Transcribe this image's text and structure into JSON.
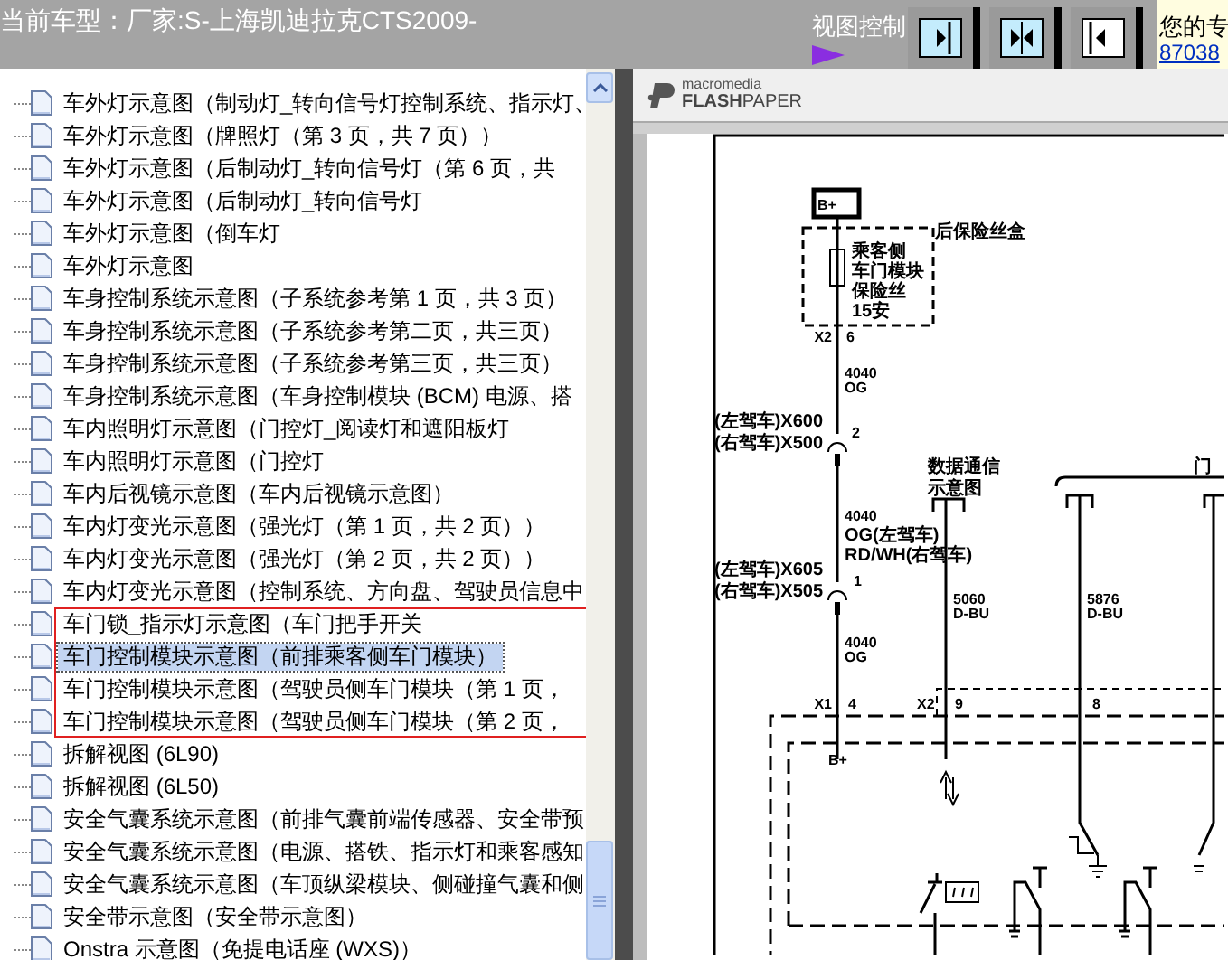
{
  "header": {
    "title": "当前车型：厂家:S-上海凯迪拉克CTS2009-",
    "view_control": "视图控制",
    "notice": "您的专",
    "notice_link": "87038"
  },
  "tree": {
    "sections": [
      {
        "framed": false,
        "items": [
          {
            "label": "车外灯示意图（制动灯_转向信号灯控制系统、指示灯、",
            "selected": false
          },
          {
            "label": "车外灯示意图（牌照灯（第 3 页，共 7 页））",
            "selected": false
          },
          {
            "label": "车外灯示意图（后制动灯_转向信号灯（第 6 页，共",
            "selected": false
          },
          {
            "label": "车外灯示意图（后制动灯_转向信号灯",
            "selected": false
          },
          {
            "label": "车外灯示意图（倒车灯",
            "selected": false
          },
          {
            "label": "车外灯示意图",
            "selected": false
          },
          {
            "label": "车身控制系统示意图（子系统参考第 1 页，共 3 页）",
            "selected": false
          },
          {
            "label": "车身控制系统示意图（子系统参考第二页，共三页）",
            "selected": false
          },
          {
            "label": "车身控制系统示意图（子系统参考第三页，共三页）",
            "selected": false
          },
          {
            "label": "车身控制系统示意图（车身控制模块 (BCM) 电源、搭",
            "selected": false
          },
          {
            "label": "车内照明灯示意图（门控灯_阅读灯和遮阳板灯",
            "selected": false
          },
          {
            "label": "车内照明灯示意图（门控灯",
            "selected": false
          },
          {
            "label": "车内后视镜示意图（车内后视镜示意图）",
            "selected": false
          },
          {
            "label": "车内灯变光示意图（强光灯（第 1 页，共 2 页））",
            "selected": false
          },
          {
            "label": "车内灯变光示意图（强光灯（第 2 页，共 2 页））",
            "selected": false
          },
          {
            "label": "车内灯变光示意图（控制系统、方向盘、驾驶员信息中",
            "selected": false
          }
        ]
      },
      {
        "framed": true,
        "items": [
          {
            "label": "车门锁_指示灯示意图（车门把手开关",
            "selected": false
          },
          {
            "label": "车门控制模块示意图（前排乘客侧车门模块）",
            "selected": true
          },
          {
            "label": "车门控制模块示意图（驾驶员侧车门模块（第 1 页，",
            "selected": false
          },
          {
            "label": "车门控制模块示意图（驾驶员侧车门模块（第 2 页，",
            "selected": false
          }
        ]
      },
      {
        "framed": false,
        "items": [
          {
            "label": "拆解视图 (6L90)",
            "selected": false
          },
          {
            "label": "拆解视图 (6L50)",
            "selected": false
          },
          {
            "label": "安全气囊系统示意图（前排气囊前端传感器、安全带预",
            "selected": false
          },
          {
            "label": "安全气囊系统示意图（电源、搭铁、指示灯和乘客感知",
            "selected": false
          },
          {
            "label": "安全气囊系统示意图（车顶纵梁模块、侧碰撞气囊和侧",
            "selected": false
          },
          {
            "label": "安全带示意图（安全带示意图）",
            "selected": false
          },
          {
            "label": "Onstra 示意图（免提电话座 (WXS)）",
            "selected": false
          }
        ]
      }
    ]
  },
  "viewer": {
    "logo_small": "macromedia",
    "logo_bold": "FLASH",
    "logo_rest": "PAPER",
    "labels": [
      "B+",
      "后保险丝盒",
      "乘客侧",
      "车门模块",
      "保险丝",
      "15安",
      "X2",
      "6",
      "4040",
      "OG",
      "(左驾车)X600",
      "(右驾车)X500",
      "2",
      "数据通信",
      "示意图",
      "门",
      "4040",
      "OG(左驾车)",
      "RD/WH(右驾车)",
      "(左驾车)X605",
      "(右驾车)X505",
      "1",
      "5060",
      "D-BU",
      "5876",
      "D-BU",
      "4040",
      "OG",
      "X1",
      "4",
      "X2",
      "9",
      "8",
      "B+"
    ]
  }
}
